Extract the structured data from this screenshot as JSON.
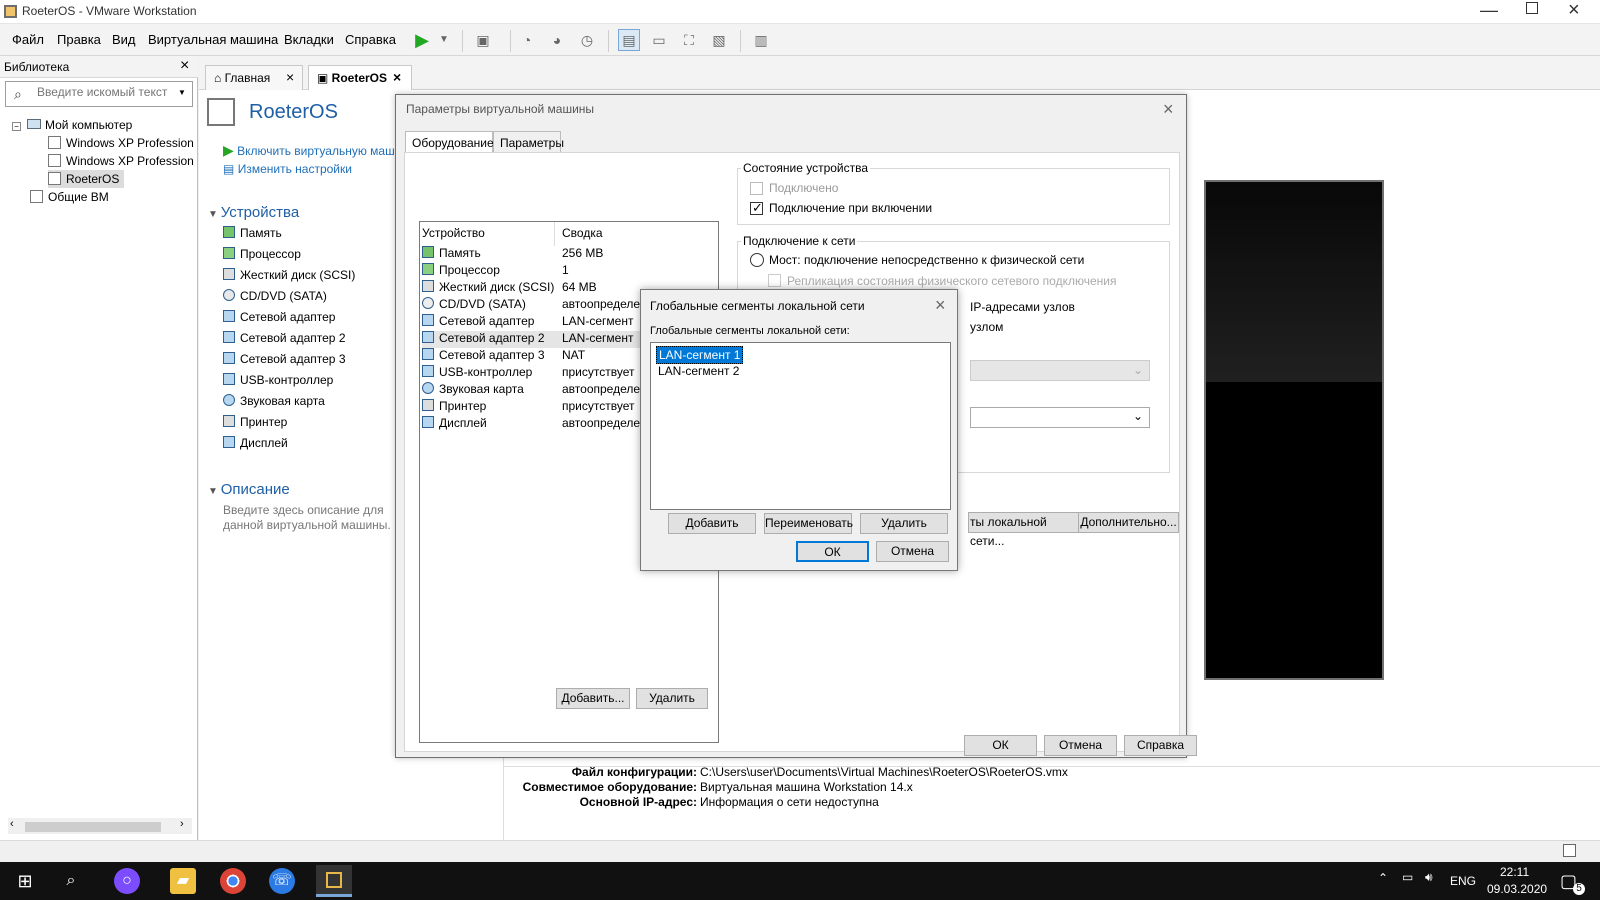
{
  "window": {
    "title": "RoeterOS - VMware Workstation"
  },
  "menu": [
    "Файл",
    "Правка",
    "Вид",
    "Виртуальная машина",
    "Вкладки",
    "Справка"
  ],
  "library": {
    "title": "Библиотека",
    "placeholder": "Введите искомый текст",
    "my_computer": "Мой компьютер",
    "items": [
      "Windows XP Professional",
      "Windows XP Professional",
      "RoeterOS"
    ],
    "shared": "Общие ВМ"
  },
  "tabs": {
    "home": "Главная",
    "vm": "RoeterOS"
  },
  "vm": {
    "title": "RoeterOS",
    "power": "Включить виртуальную машину",
    "edit": "Изменить настройки",
    "devices_title": "Устройства",
    "devices": [
      "Память",
      "Процессор",
      "Жесткий диск (SCSI)",
      "CD/DVD (SATA)",
      "Сетевой адаптер",
      "Сетевой адаптер 2",
      "Сетевой адаптер 3",
      "USB-контроллер",
      "Звуковая карта",
      "Принтер",
      "Дисплей"
    ],
    "description_title": "Описание",
    "description": "Введите здесь описание для данной виртуальной машины."
  },
  "settings": {
    "title": "Параметры виртуальной машины",
    "tab_hardware": "Оборудование",
    "tab_options": "Параметры",
    "col_device": "Устройство",
    "col_summary": "Сводка",
    "rows": [
      {
        "device": "Память",
        "summary": "256 MB"
      },
      {
        "device": "Процессор",
        "summary": "1"
      },
      {
        "device": "Жесткий диск (SCSI)",
        "summary": "64 MB"
      },
      {
        "device": "CD/DVD (SATA)",
        "summary": "автоопределение"
      },
      {
        "device": "Сетевой адаптер",
        "summary": "LAN-сегмент"
      },
      {
        "device": "Сетевой адаптер 2",
        "summary": "LAN-сегмент"
      },
      {
        "device": "Сетевой адаптер 3",
        "summary": "NAT"
      },
      {
        "device": "USB-контроллер",
        "summary": "присутствует"
      },
      {
        "device": "Звуковая карта",
        "summary": "автоопределение"
      },
      {
        "device": "Принтер",
        "summary": "присутствует"
      },
      {
        "device": "Дисплей",
        "summary": "автоопределение"
      }
    ],
    "add": "Добавить...",
    "remove": "Удалить",
    "device_status": "Состояние устройства",
    "connected": "Подключено",
    "connect_on": "Подключение при включении",
    "network": "Подключение к сети",
    "bridge": "Мост: подключение непосредственно к физической сети",
    "replicate": "Репликация состояния физического сетевого подключения",
    "ip_text": "IP-адресами узлов",
    "host_text": "узлом",
    "lan_segments_btn": "ты локальной сети...",
    "advanced": "Дополнительно...",
    "ok": "ОК",
    "cancel": "Отмена",
    "help": "Справка"
  },
  "details": {
    "config_label": "Файл конфигурации:",
    "config": "C:\\Users\\user\\Documents\\Virtual Machines\\RoeterOS\\RoeterOS.vmx",
    "compat_label": "Совместимое оборудование:",
    "compat": "Виртуальная машина Workstation 14.x",
    "ip_label": "Основной IP-адрес:",
    "ip": "Информация о сети недоступна"
  },
  "lan": {
    "title": "Глобальные сегменты локальной сети",
    "label": "Глобальные сегменты локальной сети:",
    "items": [
      "LAN-сегмент 1",
      "LAN-сегмент 2"
    ],
    "add": "Добавить",
    "rename": "Переименовать",
    "remove": "Удалить",
    "ok": "ОК",
    "cancel": "Отмена"
  },
  "taskbar": {
    "lang": "ENG",
    "time": "22:11",
    "date": "09.03.2020",
    "notifications": "5"
  }
}
